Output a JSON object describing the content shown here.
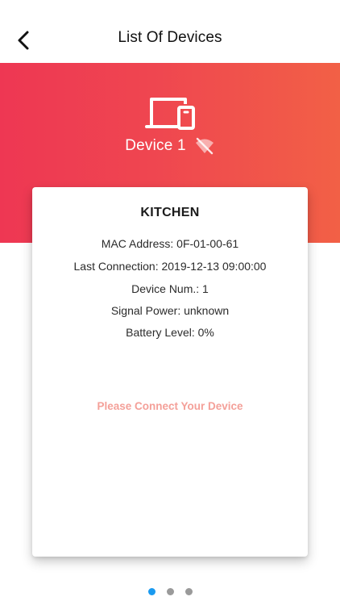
{
  "header": {
    "title": "List Of Devices",
    "back_icon": "chevron-left-icon"
  },
  "hero": {
    "gradient_start": "#ee3753",
    "gradient_end": "#f26046",
    "device_icon": "device-icon",
    "device_name": "Device 1",
    "status_icon": "wifi-off-icon"
  },
  "card": {
    "room": "KITCHEN",
    "mac_address": "MAC Address: 0F-01-00-61",
    "last_connection": "Last Connection: 2019-12-13 09:00:00",
    "device_num": "Device Num.: 1",
    "signal_power": "Signal Power: unknown",
    "battery_level": "Battery Level: 0%",
    "connect_prompt": "Please Connect Your Device",
    "connect_prompt_color": "#f4a099"
  },
  "pager": {
    "total": 3,
    "active_index": 0,
    "active_color": "#1a9af0"
  }
}
